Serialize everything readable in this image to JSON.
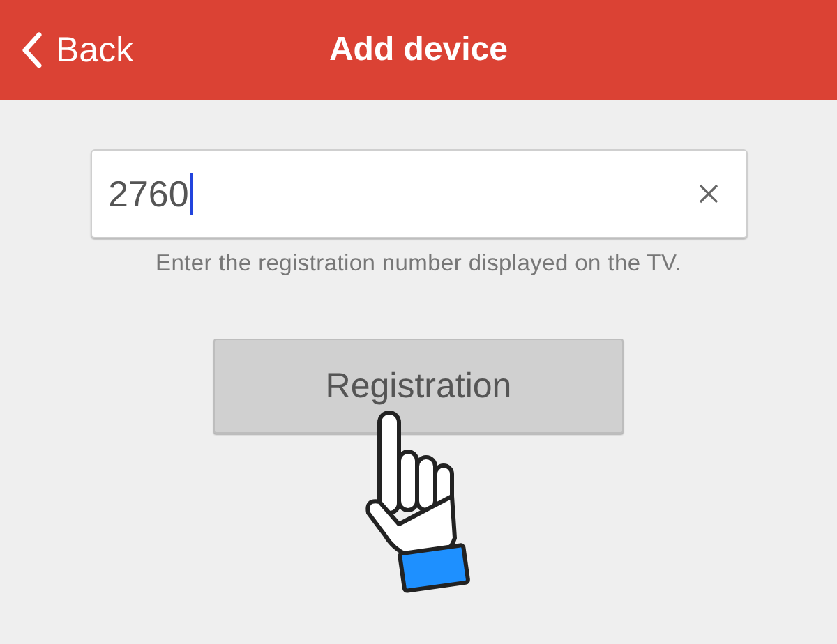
{
  "header": {
    "back_label": "Back",
    "title": "Add device"
  },
  "field": {
    "value": "2760",
    "focused": true
  },
  "hint": "Enter the registration number displayed on the TV.",
  "button": {
    "label": "Registration"
  }
}
